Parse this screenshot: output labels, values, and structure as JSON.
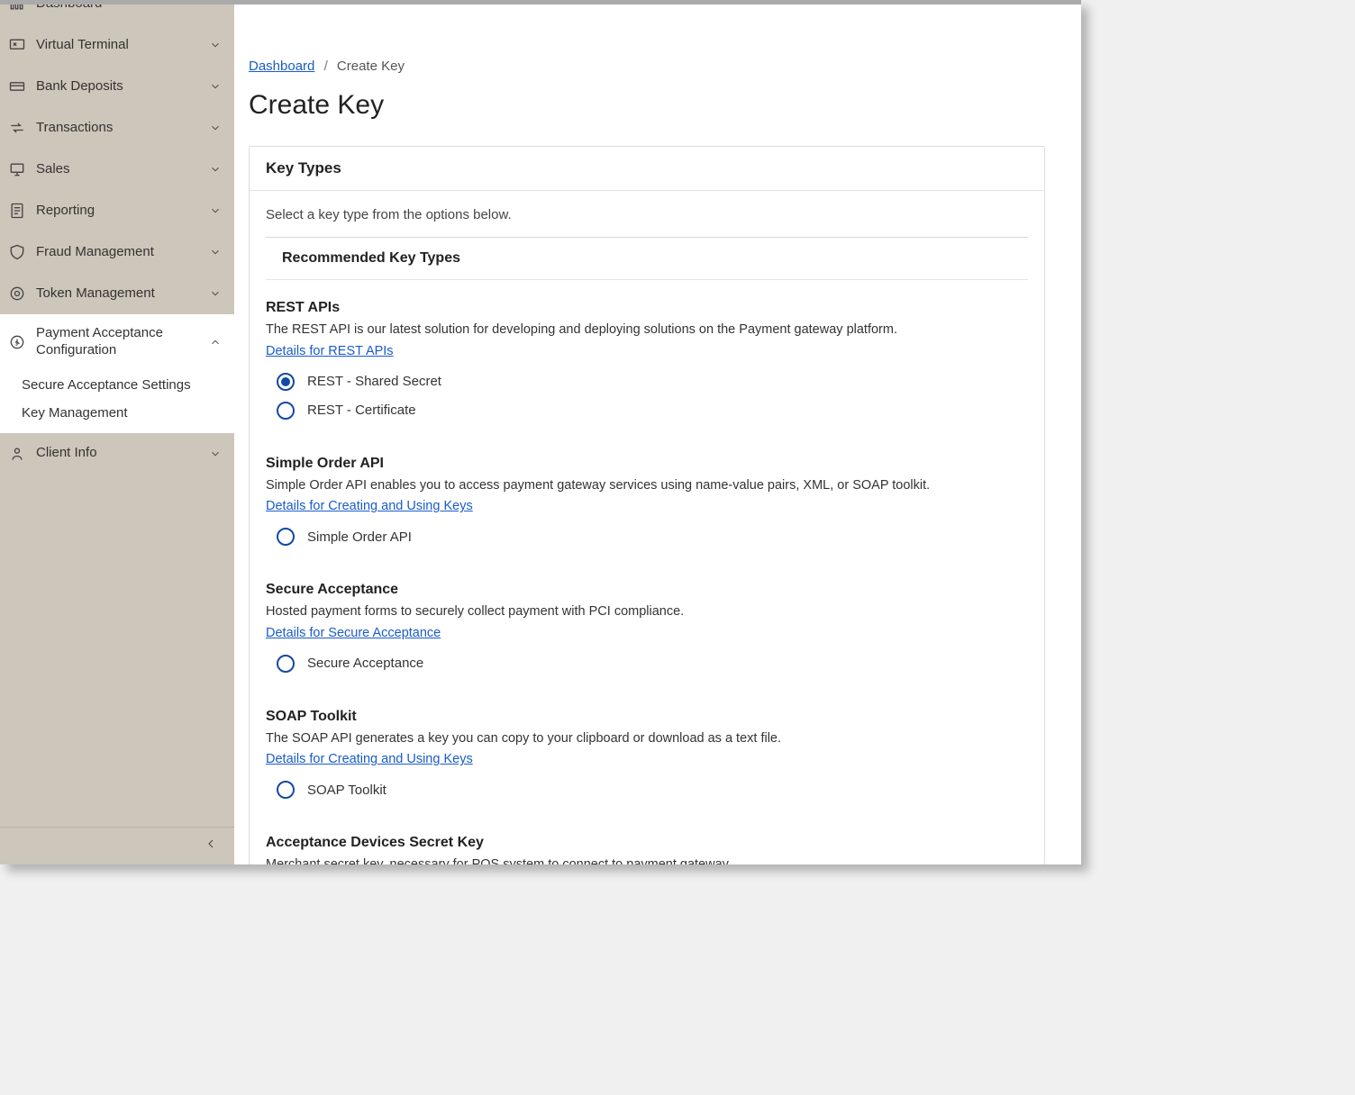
{
  "sidebar": {
    "items": [
      {
        "label": "Dashboard"
      },
      {
        "label": "Virtual Terminal"
      },
      {
        "label": "Bank Deposits"
      },
      {
        "label": "Transactions"
      },
      {
        "label": "Sales"
      },
      {
        "label": "Reporting"
      },
      {
        "label": "Fraud Management"
      },
      {
        "label": "Token Management"
      },
      {
        "label": "Payment Acceptance Configuration"
      },
      {
        "label": "Client Info"
      }
    ],
    "subitems": [
      {
        "label": "Secure Acceptance Settings"
      },
      {
        "label": "Key Management"
      }
    ]
  },
  "breadcrumb": {
    "root": "Dashboard",
    "current": "Create Key"
  },
  "page_title": "Create Key",
  "panel": {
    "header": "Key Types",
    "instruction": "Select a key type from the options below.",
    "recommended_heading": "Recommended Key Types"
  },
  "groups": {
    "rest": {
      "title": "REST APIs",
      "desc": "The REST API is our latest solution for developing and deploying solutions on the Payment gateway platform.",
      "link": "Details for REST APIs",
      "opt_shared": "REST - Shared Secret",
      "opt_cert": "REST - Certificate"
    },
    "simple": {
      "title": "Simple Order API",
      "desc": "Simple Order API enables you to access payment gateway services using name-value pairs, XML, or SOAP toolkit.",
      "link": "Details for Creating and Using Keys",
      "opt": "Simple Order API"
    },
    "secure": {
      "title": "Secure Acceptance",
      "desc": "Hosted payment forms to securely collect payment with PCI compliance.",
      "link": "Details for Secure Acceptance",
      "opt": "Secure Acceptance"
    },
    "soap": {
      "title": "SOAP Toolkit",
      "desc": "The SOAP API generates a key you can copy to your clipboard or download as a text file.",
      "link": "Details for Creating and Using Keys",
      "opt": "SOAP Toolkit"
    },
    "device": {
      "title": "Acceptance Devices Secret Key",
      "desc": "Merchant secret key, necessary for POS system to connect to payment gateway."
    }
  }
}
